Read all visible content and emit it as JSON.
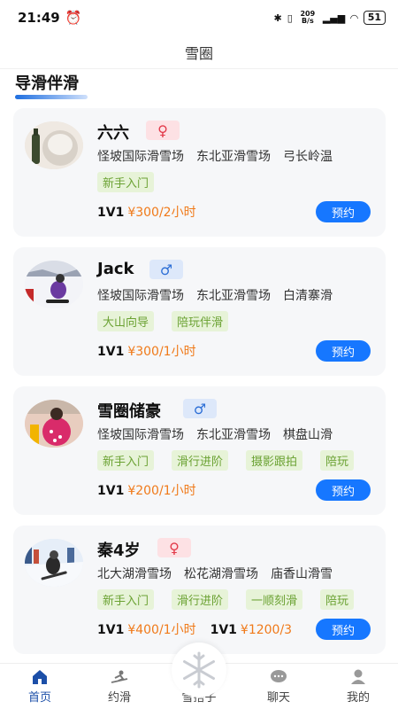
{
  "status": {
    "time": "21:49",
    "net_speed": "209 B/s",
    "battery": "51"
  },
  "header": {
    "title": "雪圈"
  },
  "section": {
    "title": "导滑伴滑"
  },
  "book_label": "预约",
  "cards": [
    {
      "name": "六六",
      "gender": "female",
      "gender_symbol": "♀",
      "venues": [
        "怪坡国际滑雪场",
        "东北亚滑雪场",
        "弓长岭温"
      ],
      "tags": [
        "新手入门"
      ],
      "prices": [
        {
          "pkg": "1V1",
          "amount": "¥300/2小时"
        }
      ]
    },
    {
      "name": "Jack",
      "gender": "male",
      "gender_symbol": "♂",
      "venues": [
        "怪坡国际滑雪场",
        "东北亚滑雪场",
        "白清寨滑"
      ],
      "tags": [
        "大山向导",
        "陪玩伴滑"
      ],
      "prices": [
        {
          "pkg": "1V1",
          "amount": "¥300/1小时"
        }
      ]
    },
    {
      "name": "雪圈储豪",
      "gender": "male",
      "gender_symbol": "♂",
      "venues": [
        "怪坡国际滑雪场",
        "东北亚滑雪场",
        "棋盘山滑"
      ],
      "tags": [
        "新手入门",
        "滑行进阶",
        "摄影跟拍",
        "陪玩"
      ],
      "prices": [
        {
          "pkg": "1V1",
          "amount": "¥200/1小时"
        }
      ]
    },
    {
      "name": "秦4岁",
      "gender": "female",
      "gender_symbol": "♀",
      "venues": [
        "北大湖滑雪场",
        "松花湖滑雪场",
        "庙香山滑雪"
      ],
      "tags": [
        "新手入门",
        "滑行进阶",
        "一顺刻滑",
        "陪玩"
      ],
      "prices": [
        {
          "pkg": "1V1",
          "amount": "¥400/1小时"
        },
        {
          "pkg": "1V1",
          "amount": "¥1200/3"
        }
      ]
    }
  ],
  "tabs": [
    {
      "label": "首页",
      "icon": "home-icon",
      "active": true
    },
    {
      "label": "约滑",
      "icon": "ski-icon",
      "active": false
    },
    {
      "label": "雪搭子",
      "icon": "snowflake-icon",
      "active": false
    },
    {
      "label": "聊天",
      "icon": "chat-icon",
      "active": false
    },
    {
      "label": "我的",
      "icon": "profile-icon",
      "active": false
    }
  ],
  "colors": {
    "accent": "#1677ff",
    "price": "#f07a1a",
    "tag_bg": "#e7f3d8",
    "tag_text": "#6ba233",
    "female": "#e23a4a",
    "male": "#2d6fd6"
  }
}
